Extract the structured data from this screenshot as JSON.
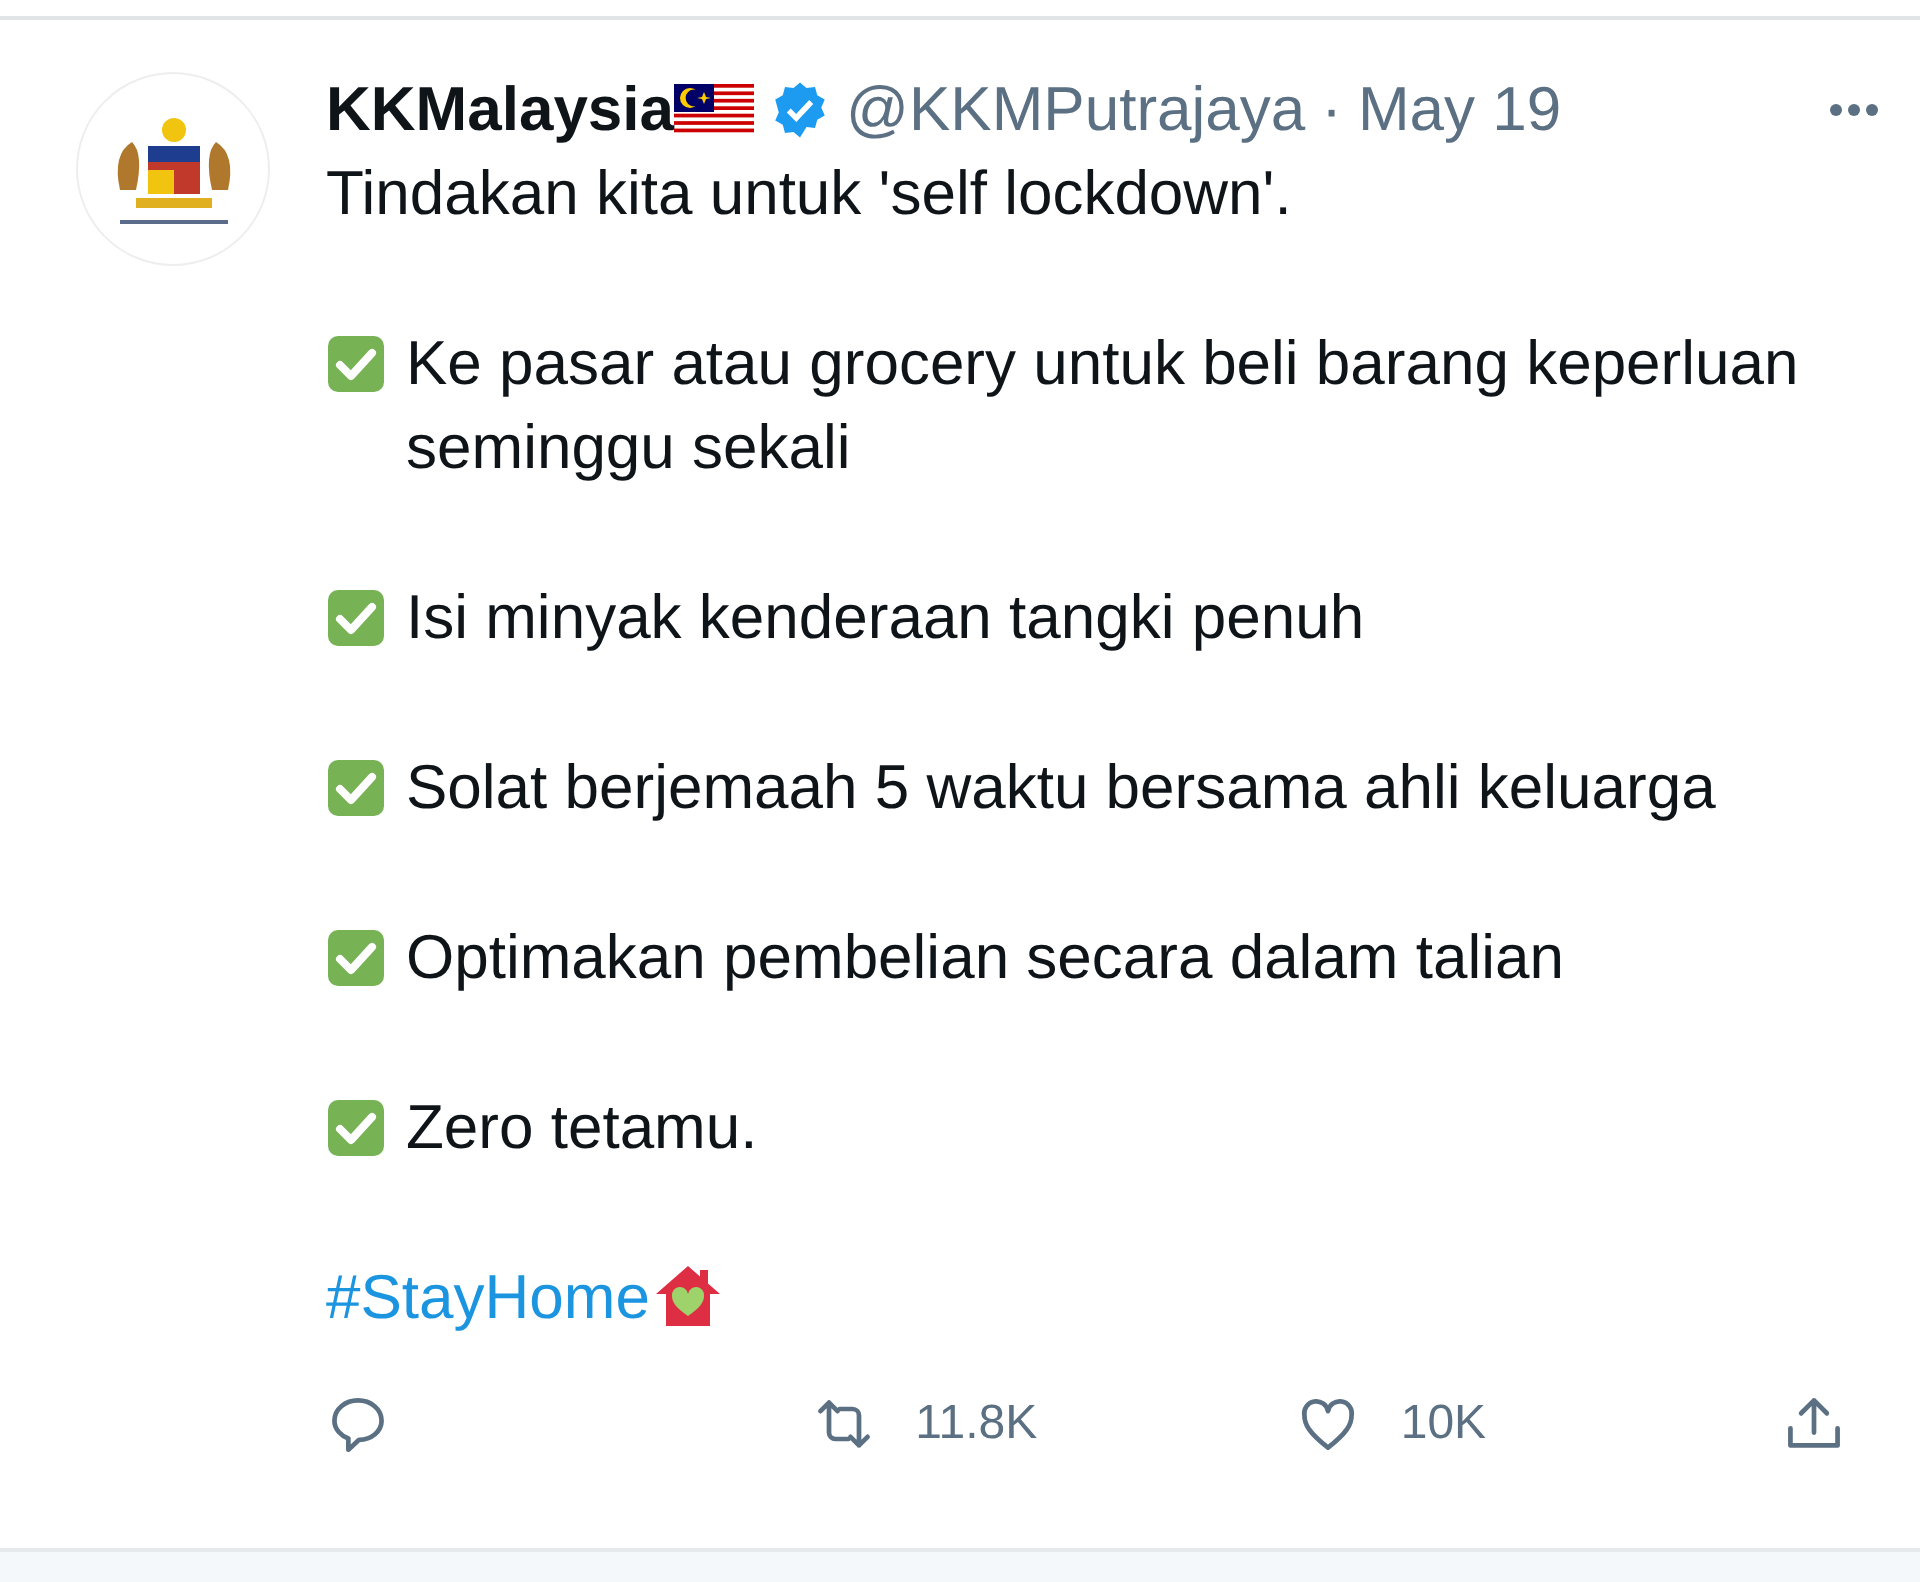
{
  "account": {
    "name": "KKMalaysia",
    "verified": true,
    "handle": "@KKMPutrajaya",
    "separator": "·",
    "date": "May 19"
  },
  "tweet": {
    "intro": "Tindakan kita untuk 'self lockdown'.",
    "items": [
      {
        "text": "Ke pasar atau grocery untuk beli barang keperluan seminggu sekali"
      },
      {
        "text": "Isi minyak kenderaan tangki penuh"
      },
      {
        "text": "Solat berjemaah 5 waktu bersama ahli keluarga"
      },
      {
        "text": "Optimakan pembelian secara dalam talian"
      },
      {
        "text": "Zero tetamu."
      }
    ],
    "hashtag": "#StayHome"
  },
  "actions": [
    {
      "kind": "reply"
    },
    {
      "kind": "retweet",
      "count": "11.8K"
    },
    {
      "kind": "like",
      "count": "10K"
    },
    {
      "kind": "share"
    }
  ]
}
